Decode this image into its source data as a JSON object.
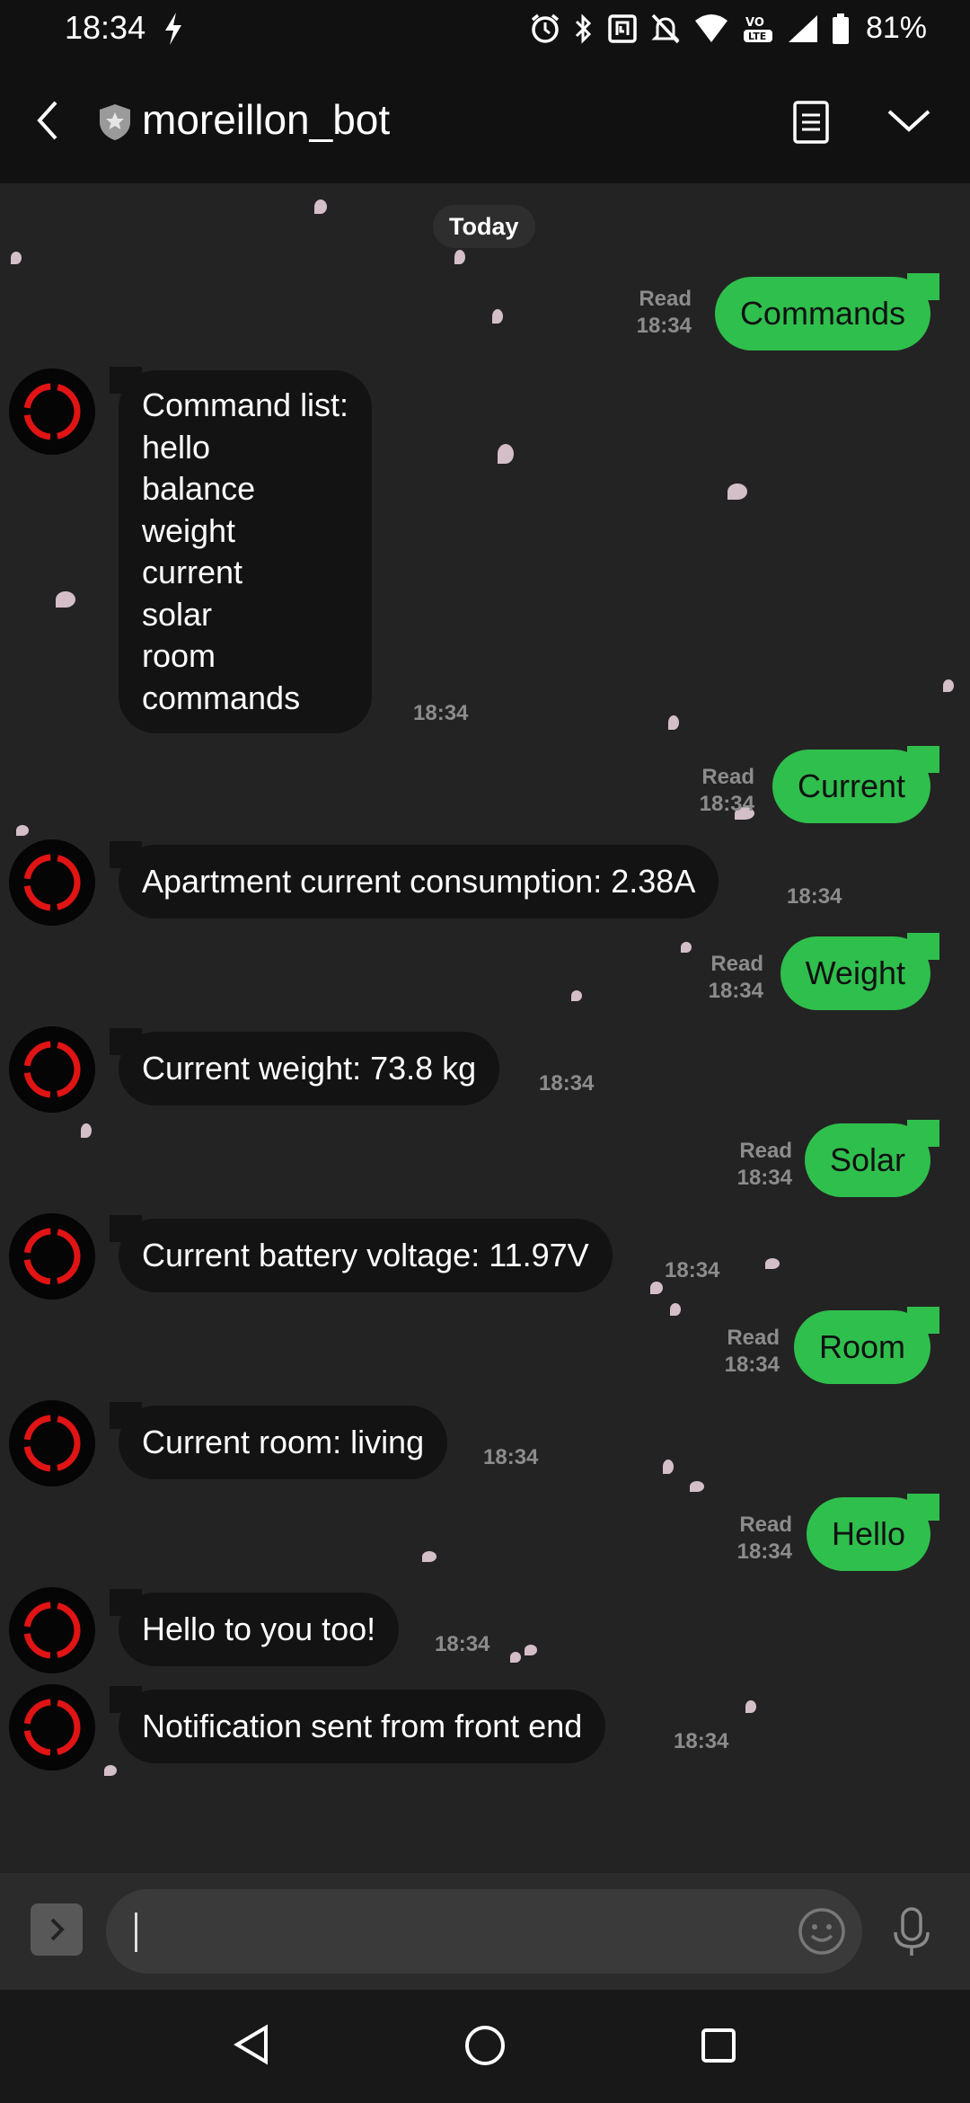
{
  "status_bar": {
    "time": "18:34",
    "battery": "81%",
    "icons": [
      "bolt-icon",
      "alarm-icon",
      "bluetooth-icon",
      "nfc-icon",
      "mute-icon",
      "wifi-icon",
      "volte-icon",
      "signal-icon",
      "battery-icon"
    ]
  },
  "header": {
    "title": "moreillon_bot",
    "icons": [
      "back-arrow-icon",
      "shield-icon",
      "notes-icon",
      "chevron-down-icon"
    ]
  },
  "chat": {
    "date_label": "Today",
    "messages": [
      {
        "direction": "out",
        "text": "Commands",
        "status": "Read",
        "time": "18:34"
      },
      {
        "direction": "in",
        "text": "Command list:\nhello\nbalance\nweight\ncurrent\nsolar\nroom\ncommands",
        "time": "18:34"
      },
      {
        "direction": "out",
        "text": "Current",
        "status": "Read",
        "time": "18:34"
      },
      {
        "direction": "in",
        "text": "Apartment current consumption: 2.38A",
        "time": "18:34"
      },
      {
        "direction": "out",
        "text": "Weight",
        "status": "Read",
        "time": "18:34"
      },
      {
        "direction": "in",
        "text": "Current weight: 73.8 kg",
        "time": "18:34"
      },
      {
        "direction": "out",
        "text": "Solar",
        "status": "Read",
        "time": "18:34"
      },
      {
        "direction": "in",
        "text": "Current battery voltage: 11.97V",
        "time": "18:34"
      },
      {
        "direction": "out",
        "text": "Room",
        "status": "Read",
        "time": "18:34"
      },
      {
        "direction": "in",
        "text": "Current room: living",
        "time": "18:34"
      },
      {
        "direction": "out",
        "text": "Hello",
        "status": "Read",
        "time": "18:34"
      },
      {
        "direction": "in",
        "text": "Hello to you too!",
        "time": "18:34"
      },
      {
        "direction": "in",
        "text": "Notification sent from front end",
        "time": "18:34"
      }
    ]
  },
  "input": {
    "value": "",
    "placeholder": ""
  },
  "colors": {
    "outgoing_bubble": "#2fbf4d",
    "incoming_bubble": "#131313",
    "background": "#232323",
    "avatar_ring": "#e01414"
  }
}
